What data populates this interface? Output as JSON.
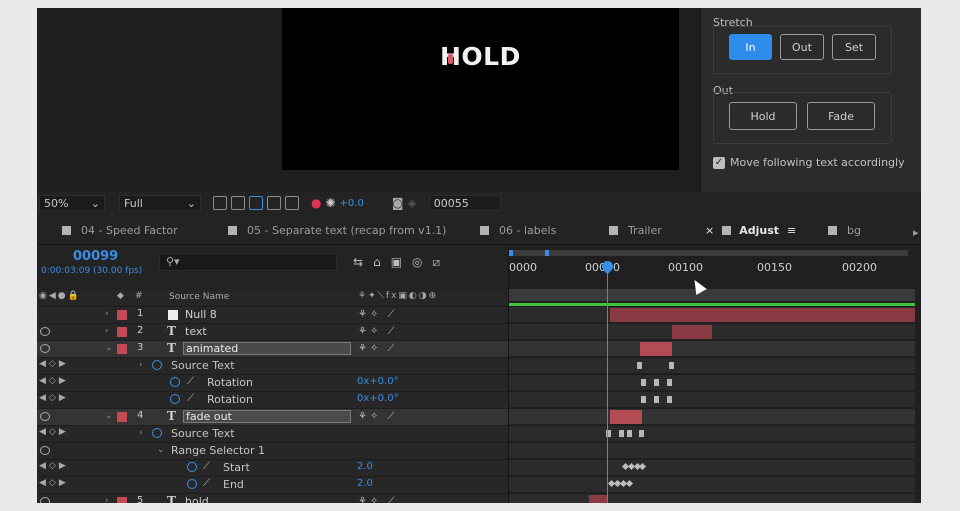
{
  "viewer": {
    "canvas_text": "HOLD",
    "zoom": "50%",
    "resolution": "Full",
    "exposure": "+0.0",
    "timecode_field": "00055"
  },
  "script_panel": {
    "stretch_label": "Stretch",
    "stretch_buttons": [
      "In",
      "Out",
      "Set"
    ],
    "active_stretch": "In",
    "out_label": "Out",
    "out_buttons": [
      "Hold",
      "Fade"
    ],
    "checkbox_label": "Move following text accordingly",
    "checkbox_checked": true
  },
  "tabs": [
    {
      "label": "04 - Speed Factor"
    },
    {
      "label": "05 - Separate text (recap from v1.1)"
    },
    {
      "label": "06 - labels"
    },
    {
      "label": "Trailer"
    },
    {
      "label": "Adjust",
      "active": true
    },
    {
      "label": "bg"
    }
  ],
  "timeline": {
    "current_frame": "00099",
    "current_time": "0:00:03:09 (30.00 fps)",
    "search_glyph": "⚲▾",
    "source_name_header": "Source Name",
    "ruler_ticks": [
      "0000",
      "00050",
      "00100",
      "00150",
      "00200"
    ],
    "playhead_frame": 99,
    "accent": "#3a8ee6",
    "label_color": "#c64a55"
  },
  "layers": [
    {
      "num": "1",
      "type": "",
      "name": "Null 8"
    },
    {
      "num": "2",
      "type": "T",
      "name": "text"
    },
    {
      "num": "3",
      "type": "T",
      "name": "animated"
    },
    {
      "prop": "Source Text"
    },
    {
      "prop": "Rotation",
      "value": "0x+0.0°"
    },
    {
      "prop": "Rotation",
      "value": "0x+0.0°"
    },
    {
      "num": "4",
      "type": "T",
      "name": "fade out"
    },
    {
      "prop": "Source Text"
    },
    {
      "prop": "Range Selector 1"
    },
    {
      "prop": "Start",
      "value": "2.0"
    },
    {
      "prop": "End",
      "value": "2.0"
    },
    {
      "num": "5",
      "type": "T",
      "name": "hold"
    }
  ]
}
